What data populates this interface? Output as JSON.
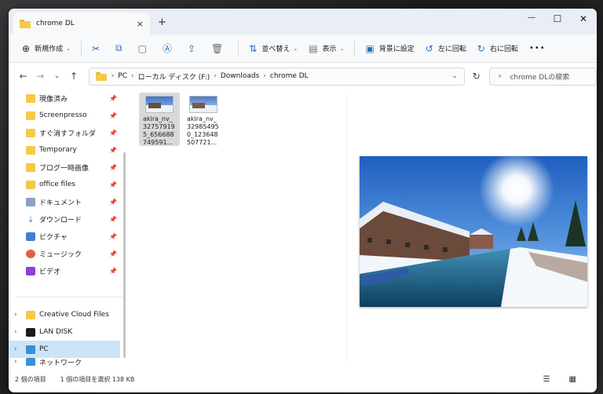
{
  "window": {
    "tab_title": "chrome DL",
    "new_tab": "+",
    "close_tab": "×",
    "minimize": "—",
    "maximize": "☐",
    "close": "✕"
  },
  "commandbar": {
    "new_label": "新規作成",
    "sort_label": "並べ替え",
    "view_label": "表示",
    "wallpaper_label": "背景に設定",
    "rotate_left_label": "左に回転",
    "rotate_right_label": "右に回転",
    "more_label": "•••",
    "icons": [
      "plus-icon",
      "cut-icon",
      "copy-icon",
      "paste-icon",
      "rename-icon",
      "share-icon",
      "delete-icon",
      "sort-icon",
      "view-icon",
      "wallpaper-icon",
      "rotate-left-icon",
      "rotate-right-icon"
    ]
  },
  "address": {
    "crumbs": [
      "PC",
      "ローカル ディスク (F:)",
      "Downloads",
      "chrome DL"
    ],
    "search_placeholder": "chrome DLの検索"
  },
  "sidebar": {
    "quick_access": [
      {
        "label": "現像済み",
        "icon": "folder-icon"
      },
      {
        "label": "Screenpresso",
        "icon": "folder-icon"
      },
      {
        "label": "すぐ消すフォルダ",
        "icon": "folder-icon"
      },
      {
        "label": "Temporary",
        "icon": "folder-icon"
      },
      {
        "label": "ブログ一時画像",
        "icon": "folder-icon"
      },
      {
        "label": "office files",
        "icon": "folder-icon"
      },
      {
        "label": "ドキュメント",
        "icon": "document-icon"
      },
      {
        "label": "ダウンロード",
        "icon": "download-icon"
      },
      {
        "label": "ピクチャ",
        "icon": "pictures-icon"
      },
      {
        "label": "ミュージック",
        "icon": "music-icon"
      },
      {
        "label": "ビデオ",
        "icon": "video-icon"
      }
    ],
    "locations": [
      {
        "label": "Creative Cloud Files",
        "icon": "creative-cloud-icon"
      },
      {
        "label": "LAN DISK",
        "icon": "lan-disk-icon"
      },
      {
        "label": "PC",
        "icon": "pc-icon"
      },
      {
        "label": "ネットワーク",
        "icon": "network-icon"
      }
    ]
  },
  "files": [
    {
      "name": "akira_nv_327579195_656688749591...",
      "selected": true
    },
    {
      "name": "akira_nv_329854950_123648507721...",
      "selected": false
    }
  ],
  "status": {
    "item_count": "2 個の項目",
    "selection": "1 個の項目を選択  138 KB"
  }
}
